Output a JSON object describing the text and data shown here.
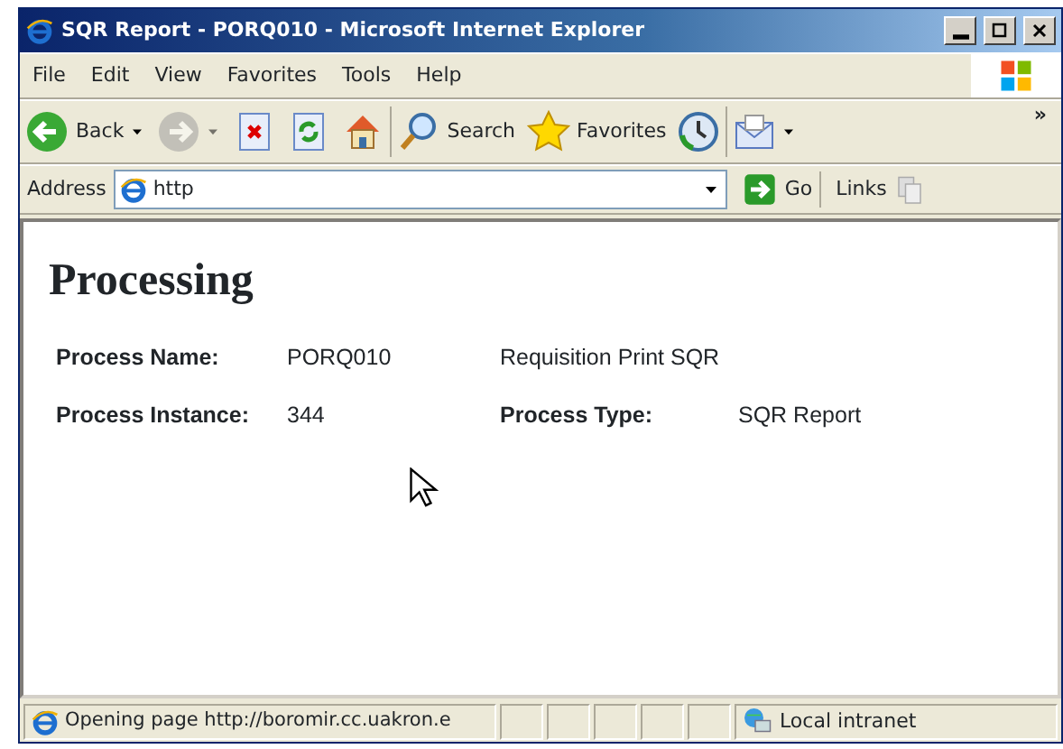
{
  "window": {
    "title": "SQR Report - PORQ010 - Microsoft Internet Explorer"
  },
  "menu": [
    "File",
    "Edit",
    "View",
    "Favorites",
    "Tools",
    "Help"
  ],
  "toolbar": [
    {
      "kind": "back",
      "label": "Back",
      "dropdown": true,
      "disabled": false
    },
    {
      "kind": "forward",
      "dropdown": true,
      "disabled": true
    },
    {
      "kind": "stop",
      "dropdown": false,
      "disabled": false
    },
    {
      "kind": "refresh",
      "dropdown": false,
      "disabled": false
    },
    {
      "kind": "home",
      "dropdown": false,
      "disabled": false
    },
    {
      "kind": "search",
      "label": "Search",
      "dropdown": false,
      "disabled": false
    },
    {
      "kind": "favorites",
      "label": "Favorites",
      "dropdown": false,
      "disabled": false
    },
    {
      "kind": "history",
      "dropdown": false,
      "disabled": false
    },
    {
      "kind": "mail",
      "dropdown": true,
      "disabled": false
    }
  ],
  "toolbar_more": "»",
  "address": {
    "label": "Address",
    "value": "http",
    "go": "Go",
    "links": "Links"
  },
  "page": {
    "heading": "Processing",
    "rows": [
      [
        {
          "kind": "label",
          "text": "Process Name:"
        },
        {
          "kind": "value",
          "text": "PORQ010"
        },
        {
          "kind": "value",
          "text": "Requisition Print SQR"
        }
      ],
      [
        {
          "kind": "label",
          "text": "Process Instance:"
        },
        {
          "kind": "value",
          "text": "344"
        },
        {
          "kind": "label",
          "text": "Process Type:"
        },
        {
          "kind": "value",
          "text": "SQR Report"
        }
      ]
    ]
  },
  "status_bar": {
    "text": "Opening page http://boromir.cc.uakron.e",
    "zone": "Local intranet"
  }
}
